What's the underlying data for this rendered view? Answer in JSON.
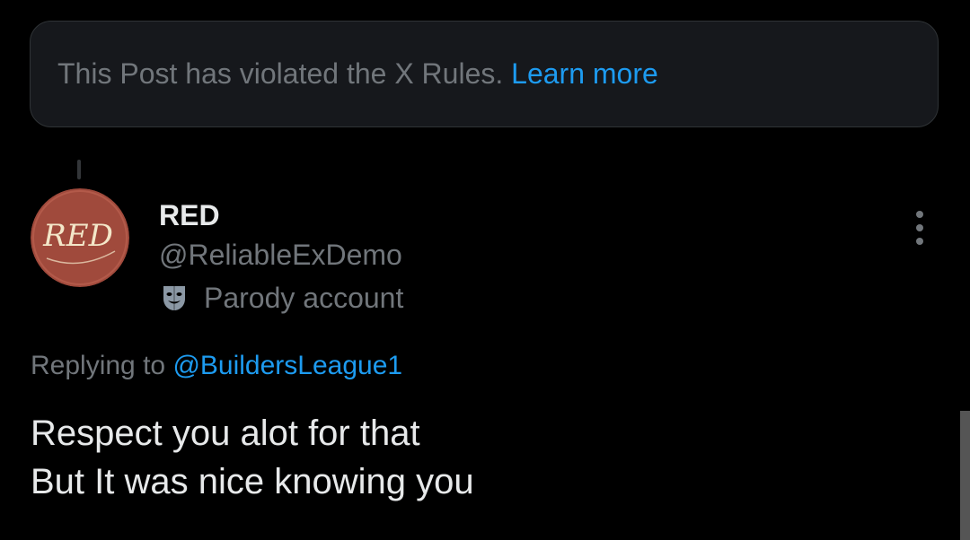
{
  "notice": {
    "text": "This Post has violated the X Rules.",
    "link": "Learn more"
  },
  "author": {
    "display_name": "RED",
    "handle": "@ReliableExDemo",
    "label": "Parody account",
    "avatar_text": "RED"
  },
  "reply": {
    "prefix": "Replying to",
    "handle": "@BuildersLeague1"
  },
  "tweet": {
    "lines": [
      "Respect you alot for that",
      "But It was nice knowing you"
    ]
  },
  "icons": {
    "parody": "theater-masks-icon",
    "more": "more-vertical-icon"
  },
  "colors": {
    "background": "#000000",
    "text_primary": "#e7e9ea",
    "text_secondary": "#71767b",
    "link": "#1d9bf0",
    "notice_background": "#16181c",
    "avatar_background": "#a04a3c",
    "avatar_text": "#f3e7c9"
  }
}
